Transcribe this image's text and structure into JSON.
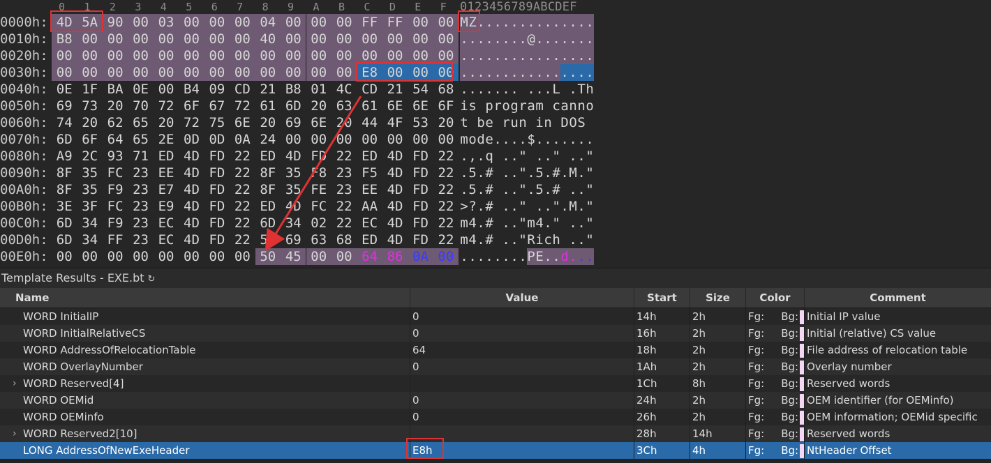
{
  "hex": {
    "columns": [
      "0",
      "1",
      "2",
      "3",
      "4",
      "5",
      "6",
      "7",
      "8",
      "9",
      "A",
      "B",
      "C",
      "D",
      "E",
      "F"
    ],
    "ascii_header": "0123456789ABCDEF",
    "rows": [
      {
        "addr": "0000h:",
        "bytes": [
          "4D",
          "5A",
          "90",
          "00",
          "03",
          "00",
          "00",
          "00",
          "04",
          "00",
          "00",
          "00",
          "FF",
          "FF",
          "00",
          "00"
        ],
        "ascii": "MZ.............."
      },
      {
        "addr": "0010h:",
        "bytes": [
          "B8",
          "00",
          "00",
          "00",
          "00",
          "00",
          "00",
          "00",
          "40",
          "00",
          "00",
          "00",
          "00",
          "00",
          "00",
          "00"
        ],
        "ascii": "........@......."
      },
      {
        "addr": "0020h:",
        "bytes": [
          "00",
          "00",
          "00",
          "00",
          "00",
          "00",
          "00",
          "00",
          "00",
          "00",
          "00",
          "00",
          "00",
          "00",
          "00",
          "00"
        ],
        "ascii": "................"
      },
      {
        "addr": "0030h:",
        "bytes": [
          "00",
          "00",
          "00",
          "00",
          "00",
          "00",
          "00",
          "00",
          "00",
          "00",
          "00",
          "00",
          "E8",
          "00",
          "00",
          "00"
        ],
        "ascii": "................"
      },
      {
        "addr": "0040h:",
        "bytes": [
          "0E",
          "1F",
          "BA",
          "0E",
          "00",
          "B4",
          "09",
          "CD",
          "21",
          "B8",
          "01",
          "4C",
          "CD",
          "21",
          "54",
          "68"
        ],
        "ascii": "....... ...L .Th"
      },
      {
        "addr": "0050h:",
        "bytes": [
          "69",
          "73",
          "20",
          "70",
          "72",
          "6F",
          "67",
          "72",
          "61",
          "6D",
          "20",
          "63",
          "61",
          "6E",
          "6E",
          "6F"
        ],
        "ascii": "is program canno"
      },
      {
        "addr": "0060h:",
        "bytes": [
          "74",
          "20",
          "62",
          "65",
          "20",
          "72",
          "75",
          "6E",
          "20",
          "69",
          "6E",
          "20",
          "44",
          "4F",
          "53",
          "20"
        ],
        "ascii": "t be run in DOS "
      },
      {
        "addr": "0070h:",
        "bytes": [
          "6D",
          "6F",
          "64",
          "65",
          "2E",
          "0D",
          "0D",
          "0A",
          "24",
          "00",
          "00",
          "00",
          "00",
          "00",
          "00",
          "00"
        ],
        "ascii": "mode....$......."
      },
      {
        "addr": "0080h:",
        "bytes": [
          "A9",
          "2C",
          "93",
          "71",
          "ED",
          "4D",
          "FD",
          "22",
          "ED",
          "4D",
          "FD",
          "22",
          "ED",
          "4D",
          "FD",
          "22"
        ],
        "ascii": ".,.q ..\" ..\" ..\""
      },
      {
        "addr": "0090h:",
        "bytes": [
          "8F",
          "35",
          "FC",
          "23",
          "EE",
          "4D",
          "FD",
          "22",
          "8F",
          "35",
          "F8",
          "23",
          "F5",
          "4D",
          "FD",
          "22"
        ],
        "ascii": ".5.# ..\".5.#.M.\""
      },
      {
        "addr": "00A0h:",
        "bytes": [
          "8F",
          "35",
          "F9",
          "23",
          "E7",
          "4D",
          "FD",
          "22",
          "8F",
          "35",
          "FE",
          "23",
          "EE",
          "4D",
          "FD",
          "22"
        ],
        "ascii": ".5.# ..\".5.# ..\""
      },
      {
        "addr": "00B0h:",
        "bytes": [
          "3E",
          "3F",
          "FC",
          "23",
          "E9",
          "4D",
          "FD",
          "22",
          "ED",
          "4D",
          "FC",
          "22",
          "AA",
          "4D",
          "FD",
          "22"
        ],
        "ascii": ">?.# ..\" ..\".M.\""
      },
      {
        "addr": "00C0h:",
        "bytes": [
          "6D",
          "34",
          "F9",
          "23",
          "EC",
          "4D",
          "FD",
          "22",
          "6D",
          "34",
          "02",
          "22",
          "EC",
          "4D",
          "FD",
          "22"
        ],
        "ascii": "m4.# ..\"m4.\" ..\""
      },
      {
        "addr": "00D0h:",
        "bytes": [
          "6D",
          "34",
          "FF",
          "23",
          "EC",
          "4D",
          "FD",
          "22",
          "52",
          "69",
          "63",
          "68",
          "ED",
          "4D",
          "FD",
          "22"
        ],
        "ascii": "m4.# ..\"Rich ..\""
      },
      {
        "addr": "00E0h:",
        "bytes": [
          "00",
          "00",
          "00",
          "00",
          "00",
          "00",
          "00",
          "00",
          "50",
          "45",
          "00",
          "00",
          "64",
          "86",
          "0A",
          "00"
        ],
        "ascii": "........PE..d..."
      }
    ]
  },
  "colors": {
    "highlight_bg": "#6e5a73",
    "selection_bg": "#2a6aa8",
    "marker_red": "#e03232",
    "magenta_byte": "#e030e0",
    "blue_byte": "#3a3aff"
  },
  "template": {
    "title": "Template Results - EXE.bt",
    "refresh_icon": "↻",
    "columns": {
      "name": "Name",
      "value": "Value",
      "start": "Start",
      "size": "Size",
      "color": "Color",
      "comment": "Comment"
    },
    "rows": [
      {
        "name": "WORD InitialIP",
        "value": "0",
        "start": "14h",
        "size": "2h",
        "fg": "Fg:",
        "bg": "Bg:",
        "comment": "Initial IP value",
        "expandable": false
      },
      {
        "name": "WORD InitialRelativeCS",
        "value": "0",
        "start": "16h",
        "size": "2h",
        "fg": "Fg:",
        "bg": "Bg:",
        "comment": "Initial (relative) CS value",
        "expandable": false
      },
      {
        "name": "WORD AddressOfRelocationTable",
        "value": "64",
        "start": "18h",
        "size": "2h",
        "fg": "Fg:",
        "bg": "Bg:",
        "comment": "File address of relocation table",
        "expandable": false
      },
      {
        "name": "WORD OverlayNumber",
        "value": "0",
        "start": "1Ah",
        "size": "2h",
        "fg": "Fg:",
        "bg": "Bg:",
        "comment": "Overlay number",
        "expandable": false
      },
      {
        "name": "WORD Reserved[4]",
        "value": "",
        "start": "1Ch",
        "size": "8h",
        "fg": "Fg:",
        "bg": "Bg:",
        "comment": "Reserved words",
        "expandable": true
      },
      {
        "name": "WORD OEMid",
        "value": "0",
        "start": "24h",
        "size": "2h",
        "fg": "Fg:",
        "bg": "Bg:",
        "comment": "OEM identifier (for OEMinfo)",
        "expandable": false
      },
      {
        "name": "WORD OEMinfo",
        "value": "0",
        "start": "26h",
        "size": "2h",
        "fg": "Fg:",
        "bg": "Bg:",
        "comment": "OEM information; OEMid specific",
        "expandable": false
      },
      {
        "name": "WORD Reserved2[10]",
        "value": "",
        "start": "28h",
        "size": "14h",
        "fg": "Fg:",
        "bg": "Bg:",
        "comment": "Reserved words",
        "expandable": true
      },
      {
        "name": "LONG AddressOfNewExeHeader",
        "value": "E8h",
        "start": "3Ch",
        "size": "4h",
        "fg": "Fg:",
        "bg": "Bg:",
        "comment": "NtHeader Offset",
        "expandable": false
      }
    ]
  }
}
